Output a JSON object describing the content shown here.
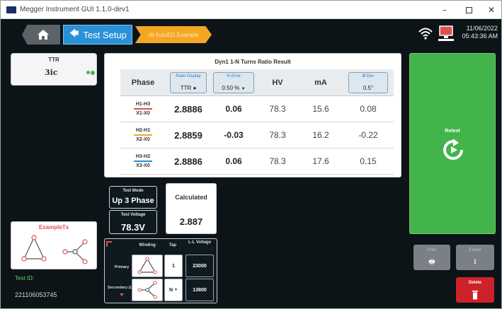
{
  "window": {
    "title": "Megger Instrument GUI 1.1.0-dev1",
    "minimize_glyph": "–",
    "close_glyph": "✕"
  },
  "header": {
    "breadcrumb_label": "Test Setup",
    "breadcrumb_arrow": "🡄",
    "orange_tab_label": "dit AutoED Example",
    "date": "11/06/2022",
    "time": "05:43:36 AM"
  },
  "left_panel": {
    "ttr_label": "TTR",
    "tap_symbol": "3ic",
    "example_label": "ExampleTx",
    "test_id_label": "Test ID:",
    "test_id_value": "221106053745"
  },
  "result": {
    "title": "Dyn1 1-N Turns Ratio Result",
    "headers": {
      "phase": "Phase",
      "ratio_small": "Ratio Display",
      "ratio_value": "TTR ●",
      "error_small": "% Error",
      "error_value": "0.50 %",
      "hv": "HV",
      "ma": "mA",
      "dev_small": "Ø Dev",
      "dev_value": "0.5°"
    },
    "rows": [
      {
        "hv_phase": "H1-H3",
        "lv_phase": "X1-X0",
        "bar_color": "#e2504e",
        "ratio": "2.8886",
        "error": "0.06",
        "hv": "78.3",
        "ma": "15.6",
        "dev": "0.08"
      },
      {
        "hv_phase": "H2-H1",
        "lv_phase": "X2-X0",
        "bar_color": "#f5a623",
        "ratio": "2.8859",
        "error": "-0.03",
        "hv": "78.3",
        "ma": "16.2",
        "dev": "-0.22"
      },
      {
        "hv_phase": "H3-H2",
        "lv_phase": "X3-X0",
        "bar_color": "#2a91d8",
        "ratio": "2.8886",
        "error": "0.06",
        "hv": "78.3",
        "ma": "17.6",
        "dev": "0.15"
      }
    ]
  },
  "test_mode": {
    "label": "Test Mode",
    "value": "Up 3 Phase"
  },
  "test_voltage": {
    "label": "Test Voltage",
    "value": "78.3V"
  },
  "calculated": {
    "label": "Calculated",
    "value": "2.887"
  },
  "winding": {
    "h_winding": "Winding",
    "h_tap": "Tap",
    "h_voltage": "L-L Voltage",
    "primary_label": "Primary",
    "secondary_label": "Secondary (LV)",
    "primary_tap": "1",
    "secondary_tap": "N",
    "primary_voltage": "23000",
    "secondary_voltage": "13800"
  },
  "actions": {
    "retest": "Retest",
    "print": "Print",
    "export": "Export",
    "delete": "Delete"
  },
  "colors": {
    "retest_green": "#43b44b",
    "delete_red": "#cc2229",
    "accent_blue": "#2a91d8",
    "accent_orange": "#f5a623"
  }
}
